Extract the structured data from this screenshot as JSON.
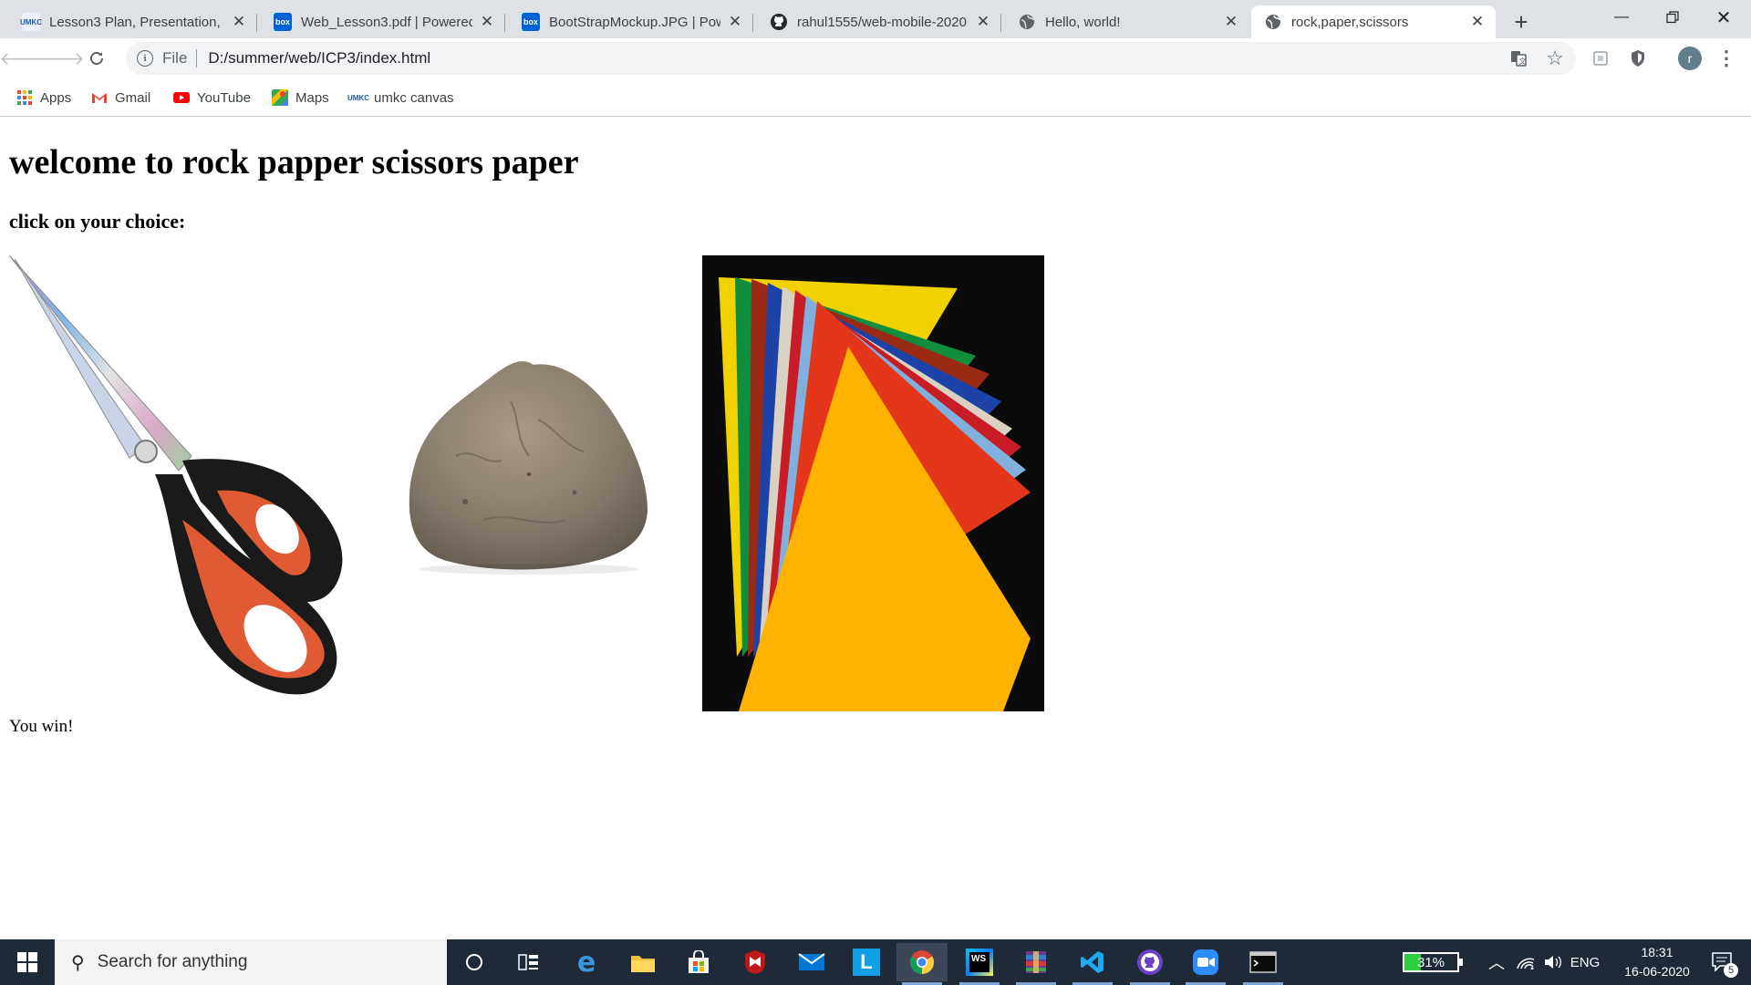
{
  "browser": {
    "tabs": [
      {
        "title": "Lesson3 Plan, Presentation, S",
        "favicon": "umkc-icon"
      },
      {
        "title": "Web_Lesson3.pdf | Powered",
        "favicon": "box-icon"
      },
      {
        "title": "BootStrapMockup.JPG | Powe",
        "favicon": "box-icon"
      },
      {
        "title": "rahul1555/web-mobile-2020",
        "favicon": "github-icon"
      },
      {
        "title": "Hello, world!",
        "favicon": "globe-icon"
      },
      {
        "title": "rock,paper,scissors",
        "favicon": "globe-icon",
        "active": true
      }
    ],
    "address": {
      "scheme": "File",
      "url": "D:/summer/web/ICP3/index.html"
    },
    "profile_initial": "r",
    "bookmarks": [
      {
        "label": "Apps",
        "icon": "apps-grid-icon"
      },
      {
        "label": "Gmail",
        "icon": "gmail-icon"
      },
      {
        "label": "YouTube",
        "icon": "youtube-icon"
      },
      {
        "label": "Maps",
        "icon": "maps-icon"
      },
      {
        "label": "umkc canvas",
        "icon": "umkc-icon"
      }
    ]
  },
  "page": {
    "heading": "welcome to rock papper scissors paper",
    "subheading": "click on your choice:",
    "choices": [
      "scissors",
      "rock",
      "paper"
    ],
    "result": "You win!"
  },
  "taskbar": {
    "search_placeholder": "Search for anything",
    "battery_percent": "31%",
    "battery_level": 0.31,
    "language": "ENG",
    "time": "18:31",
    "date": "16-06-2020",
    "notification_count": "5"
  },
  "colors": {
    "tabstrip": "#dee1e6",
    "taskbar": "#1f2a38",
    "battery_fill": "#2ecc40"
  }
}
